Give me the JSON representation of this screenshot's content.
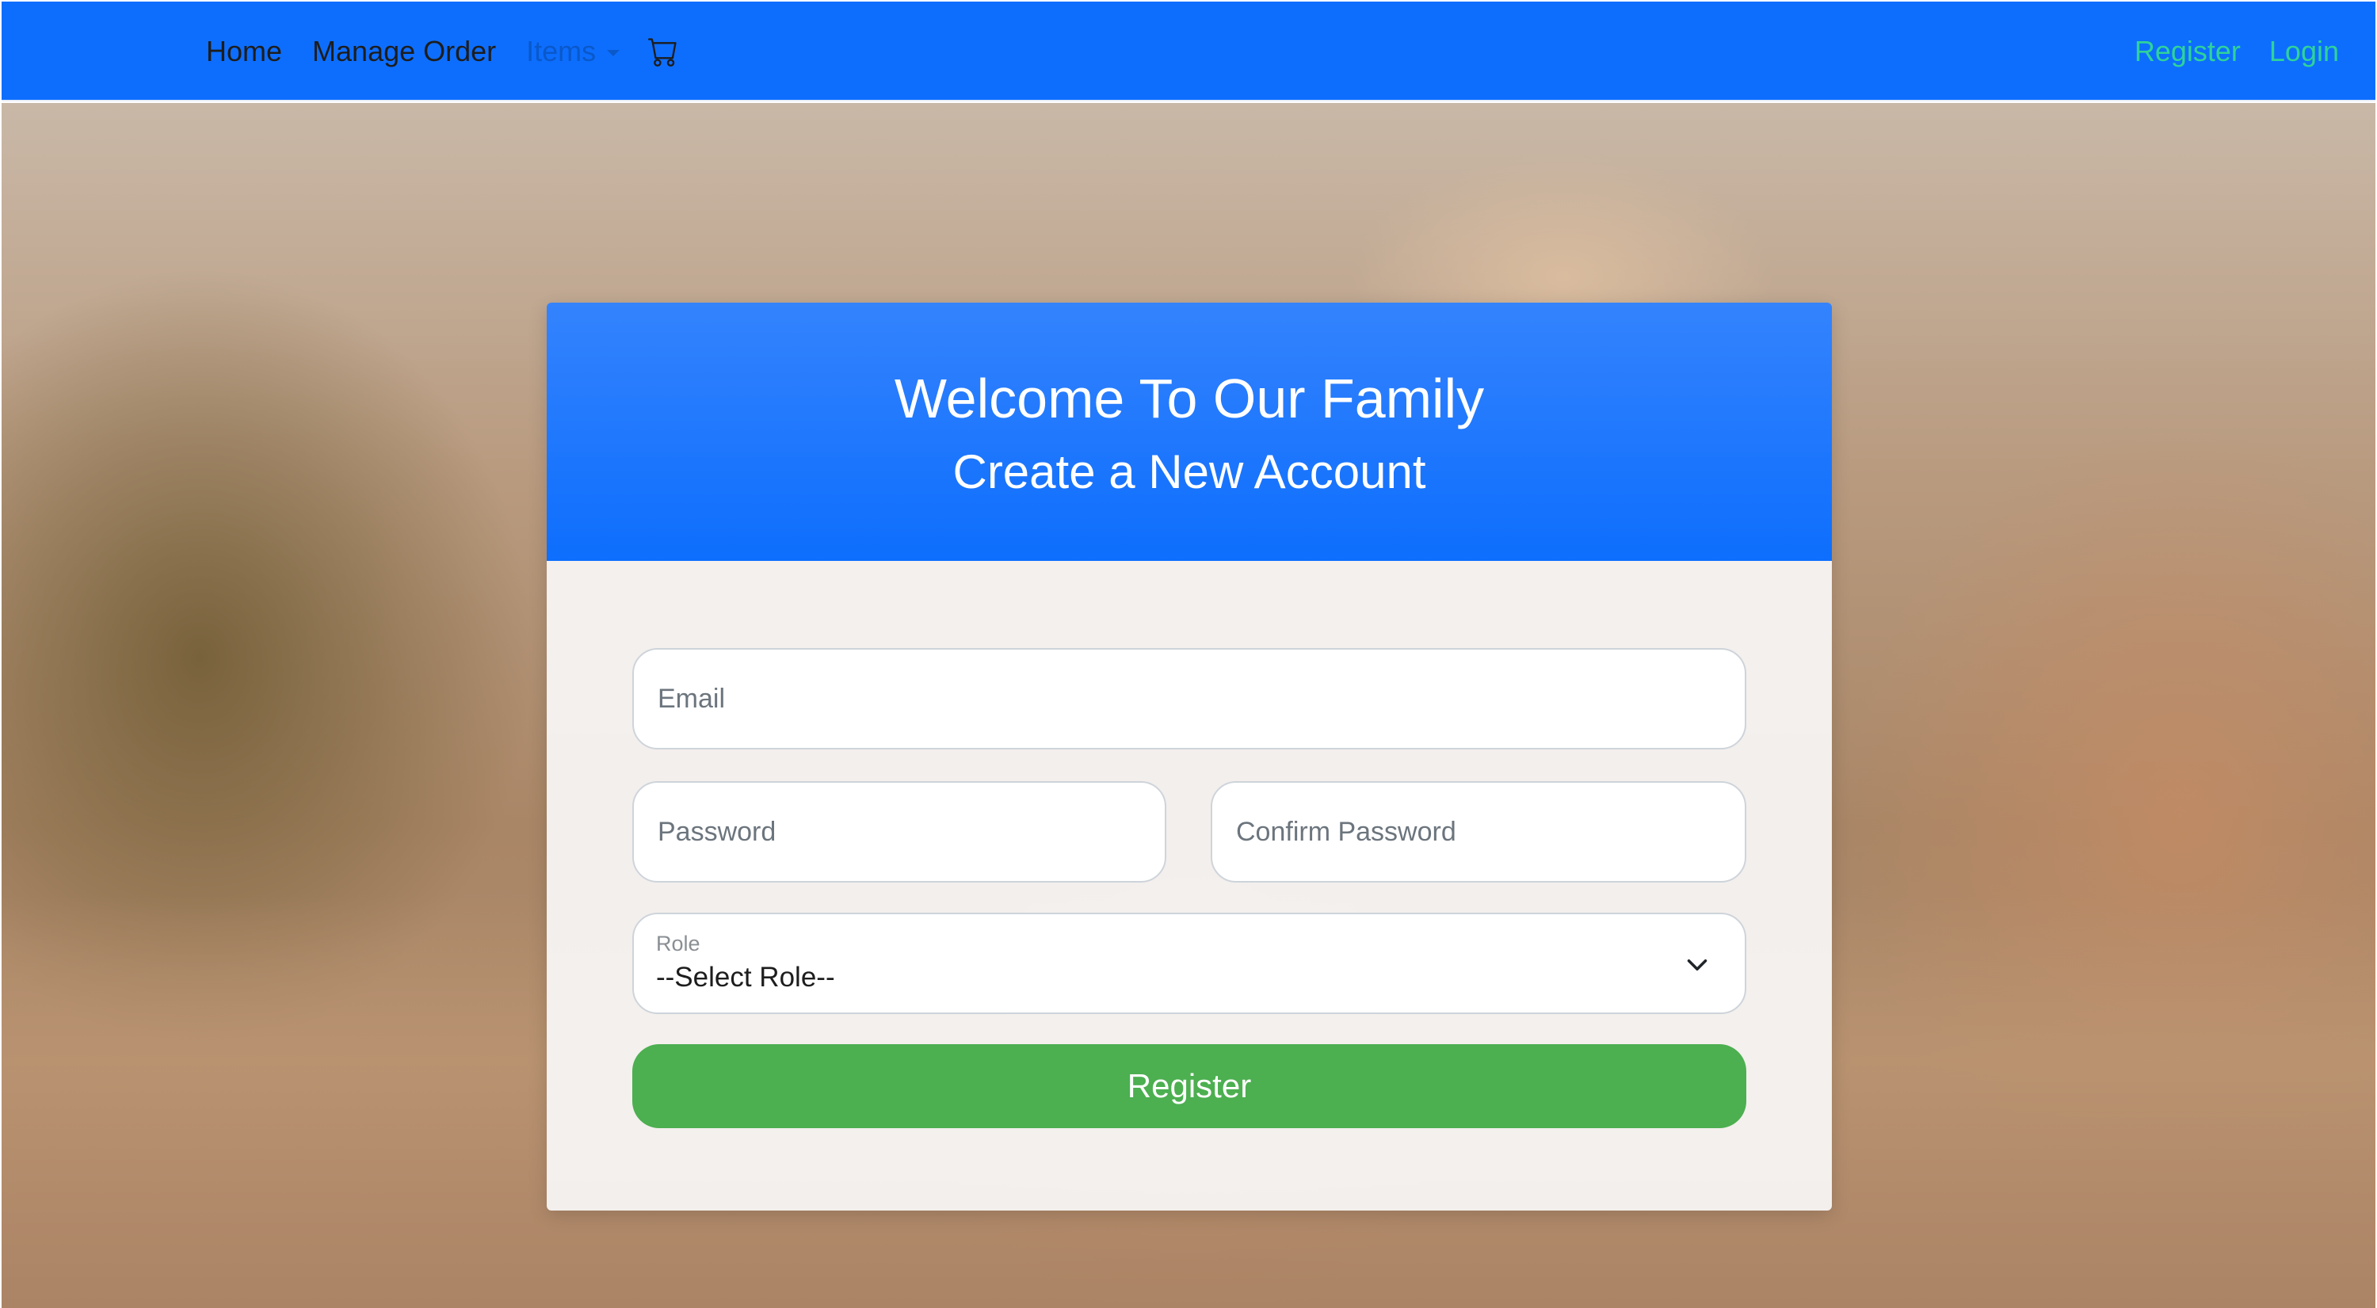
{
  "navbar": {
    "links": {
      "home": "Home",
      "manage_order": "Manage Order",
      "items": "Items",
      "register": "Register",
      "login": "Login"
    },
    "cart_icon": "cart-icon",
    "colors": {
      "background": "#0d6efd",
      "link": "#1d1d1d",
      "dropdown": "#0a58ca",
      "auth_links": "#2fd29a"
    }
  },
  "card": {
    "title": "Welcome To Our Family",
    "subtitle": "Create a New Account",
    "header_color": "#0d6efd"
  },
  "form": {
    "email": {
      "placeholder": "Email",
      "value": ""
    },
    "password": {
      "placeholder": "Password",
      "value": ""
    },
    "confirm_password": {
      "placeholder": "Confirm Password",
      "value": ""
    },
    "role": {
      "label": "Role",
      "selected": "--Select Role--",
      "icon": "chevron-down-icon"
    },
    "submit": {
      "label": "Register",
      "color": "#4caf50"
    }
  },
  "background": {
    "description_icon": "dogs-photo"
  }
}
